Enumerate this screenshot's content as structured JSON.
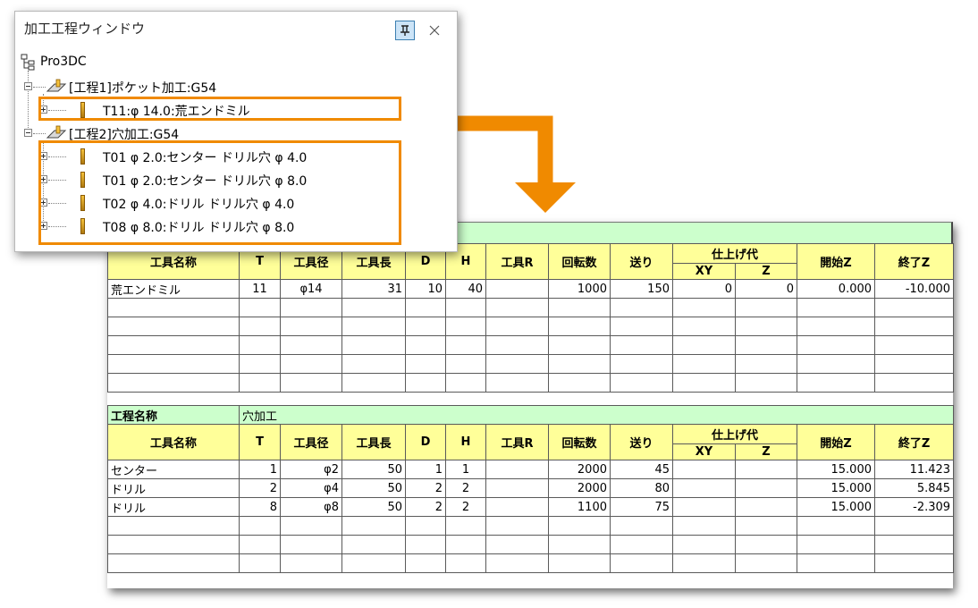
{
  "window": {
    "title": "加工工程ウィンドウ",
    "pin_symbol": "ᛘ",
    "close_symbol": "×"
  },
  "tree": {
    "root": "Pro3DC",
    "process1": {
      "label": "[工程1]ポケット加工:G54",
      "tools": [
        "T11:φ 14.0:荒エンドミル"
      ]
    },
    "process2": {
      "label": "[工程2]穴加工:G54",
      "tools": [
        "T01  φ 2.0:センター ドリル穴  φ 4.0",
        "T01  φ 2.0:センター ドリル穴  φ 8.0",
        "T02  φ 4.0:ドリル ドリル穴  φ 4.0",
        "T08  φ 8.0:ドリル ドリル穴  φ 8.0"
      ]
    }
  },
  "colors": {
    "highlight": "#f08a00",
    "header_yellow": "#ffff99",
    "process_green": "#ccffcc"
  },
  "sheet": {
    "headers": {
      "tool_name": "工具名称",
      "t": "T",
      "diameter": "工具径",
      "length": "工具長",
      "d": "D",
      "h": "H",
      "r": "工具R",
      "rpm": "回転数",
      "feed": "送り",
      "allowance": "仕上げ代",
      "xy": "XY",
      "z": "Z",
      "start_z": "開始Z",
      "end_z": "終了Z"
    },
    "table1": {
      "rows": [
        [
          "荒エンドミル",
          "11",
          "φ14",
          "31",
          "10",
          "40",
          "",
          "1000",
          "150",
          "0",
          "0",
          "0.000",
          "-10.000"
        ]
      ]
    },
    "table2": {
      "process_label": "工程名称",
      "process_value": "穴加工",
      "rows": [
        [
          "センター",
          "1",
          "φ2",
          "50",
          "1",
          "1",
          "",
          "2000",
          "45",
          "",
          "",
          "15.000",
          "11.423"
        ],
        [
          "ドリル",
          "2",
          "φ4",
          "50",
          "2",
          "2",
          "",
          "2000",
          "80",
          "",
          "",
          "15.000",
          "5.845"
        ],
        [
          "ドリル",
          "8",
          "φ8",
          "50",
          "2",
          "2",
          "",
          "1100",
          "75",
          "",
          "",
          "15.000",
          "-2.309"
        ]
      ]
    }
  }
}
